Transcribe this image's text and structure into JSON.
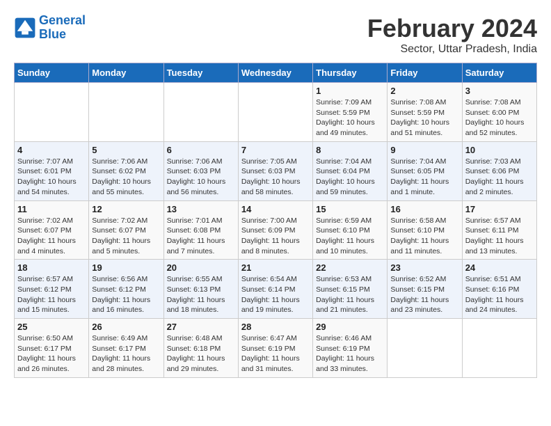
{
  "logo": {
    "line1": "General",
    "line2": "Blue"
  },
  "title": "February 2024",
  "subtitle": "Sector, Uttar Pradesh, India",
  "days_header": [
    "Sunday",
    "Monday",
    "Tuesday",
    "Wednesday",
    "Thursday",
    "Friday",
    "Saturday"
  ],
  "weeks": [
    [
      {
        "num": "",
        "detail": ""
      },
      {
        "num": "",
        "detail": ""
      },
      {
        "num": "",
        "detail": ""
      },
      {
        "num": "",
        "detail": ""
      },
      {
        "num": "1",
        "detail": "Sunrise: 7:09 AM\nSunset: 5:59 PM\nDaylight: 10 hours\nand 49 minutes."
      },
      {
        "num": "2",
        "detail": "Sunrise: 7:08 AM\nSunset: 5:59 PM\nDaylight: 10 hours\nand 51 minutes."
      },
      {
        "num": "3",
        "detail": "Sunrise: 7:08 AM\nSunset: 6:00 PM\nDaylight: 10 hours\nand 52 minutes."
      }
    ],
    [
      {
        "num": "4",
        "detail": "Sunrise: 7:07 AM\nSunset: 6:01 PM\nDaylight: 10 hours\nand 54 minutes."
      },
      {
        "num": "5",
        "detail": "Sunrise: 7:06 AM\nSunset: 6:02 PM\nDaylight: 10 hours\nand 55 minutes."
      },
      {
        "num": "6",
        "detail": "Sunrise: 7:06 AM\nSunset: 6:03 PM\nDaylight: 10 hours\nand 56 minutes."
      },
      {
        "num": "7",
        "detail": "Sunrise: 7:05 AM\nSunset: 6:03 PM\nDaylight: 10 hours\nand 58 minutes."
      },
      {
        "num": "8",
        "detail": "Sunrise: 7:04 AM\nSunset: 6:04 PM\nDaylight: 10 hours\nand 59 minutes."
      },
      {
        "num": "9",
        "detail": "Sunrise: 7:04 AM\nSunset: 6:05 PM\nDaylight: 11 hours\nand 1 minute."
      },
      {
        "num": "10",
        "detail": "Sunrise: 7:03 AM\nSunset: 6:06 PM\nDaylight: 11 hours\nand 2 minutes."
      }
    ],
    [
      {
        "num": "11",
        "detail": "Sunrise: 7:02 AM\nSunset: 6:07 PM\nDaylight: 11 hours\nand 4 minutes."
      },
      {
        "num": "12",
        "detail": "Sunrise: 7:02 AM\nSunset: 6:07 PM\nDaylight: 11 hours\nand 5 minutes."
      },
      {
        "num": "13",
        "detail": "Sunrise: 7:01 AM\nSunset: 6:08 PM\nDaylight: 11 hours\nand 7 minutes."
      },
      {
        "num": "14",
        "detail": "Sunrise: 7:00 AM\nSunset: 6:09 PM\nDaylight: 11 hours\nand 8 minutes."
      },
      {
        "num": "15",
        "detail": "Sunrise: 6:59 AM\nSunset: 6:10 PM\nDaylight: 11 hours\nand 10 minutes."
      },
      {
        "num": "16",
        "detail": "Sunrise: 6:58 AM\nSunset: 6:10 PM\nDaylight: 11 hours\nand 11 minutes."
      },
      {
        "num": "17",
        "detail": "Sunrise: 6:57 AM\nSunset: 6:11 PM\nDaylight: 11 hours\nand 13 minutes."
      }
    ],
    [
      {
        "num": "18",
        "detail": "Sunrise: 6:57 AM\nSunset: 6:12 PM\nDaylight: 11 hours\nand 15 minutes."
      },
      {
        "num": "19",
        "detail": "Sunrise: 6:56 AM\nSunset: 6:12 PM\nDaylight: 11 hours\nand 16 minutes."
      },
      {
        "num": "20",
        "detail": "Sunrise: 6:55 AM\nSunset: 6:13 PM\nDaylight: 11 hours\nand 18 minutes."
      },
      {
        "num": "21",
        "detail": "Sunrise: 6:54 AM\nSunset: 6:14 PM\nDaylight: 11 hours\nand 19 minutes."
      },
      {
        "num": "22",
        "detail": "Sunrise: 6:53 AM\nSunset: 6:15 PM\nDaylight: 11 hours\nand 21 minutes."
      },
      {
        "num": "23",
        "detail": "Sunrise: 6:52 AM\nSunset: 6:15 PM\nDaylight: 11 hours\nand 23 minutes."
      },
      {
        "num": "24",
        "detail": "Sunrise: 6:51 AM\nSunset: 6:16 PM\nDaylight: 11 hours\nand 24 minutes."
      }
    ],
    [
      {
        "num": "25",
        "detail": "Sunrise: 6:50 AM\nSunset: 6:17 PM\nDaylight: 11 hours\nand 26 minutes."
      },
      {
        "num": "26",
        "detail": "Sunrise: 6:49 AM\nSunset: 6:17 PM\nDaylight: 11 hours\nand 28 minutes."
      },
      {
        "num": "27",
        "detail": "Sunrise: 6:48 AM\nSunset: 6:18 PM\nDaylight: 11 hours\nand 29 minutes."
      },
      {
        "num": "28",
        "detail": "Sunrise: 6:47 AM\nSunset: 6:19 PM\nDaylight: 11 hours\nand 31 minutes."
      },
      {
        "num": "29",
        "detail": "Sunrise: 6:46 AM\nSunset: 6:19 PM\nDaylight: 11 hours\nand 33 minutes."
      },
      {
        "num": "",
        "detail": ""
      },
      {
        "num": "",
        "detail": ""
      }
    ]
  ]
}
